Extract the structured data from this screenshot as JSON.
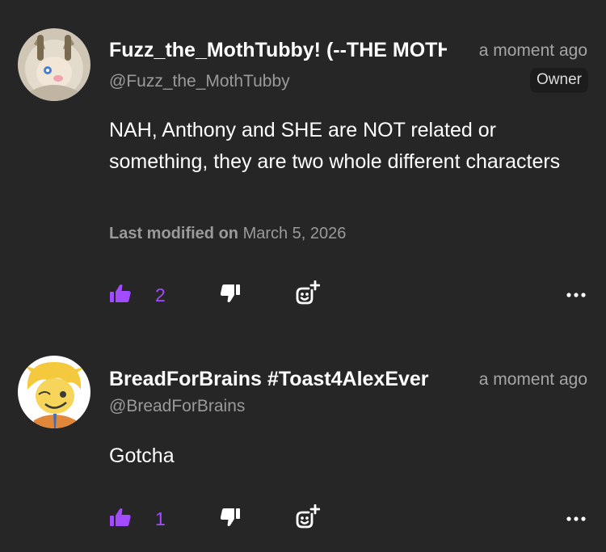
{
  "theme": {
    "background": "#262626",
    "accent": "#a24bff",
    "muted_text": "#9a9a9a"
  },
  "comments": [
    {
      "avatar_icon": "moth-character-avatar",
      "display_name": "Fuzz_the_MothTubby! (--THE MOTH",
      "timestamp": "a moment ago",
      "handle": "@Fuzz_the_MothTubby",
      "badge": "Owner",
      "body": "NAH, Anthony and SHE are NOT related or something, they are two whole different characters",
      "modified_label": "Last modified on",
      "modified_date": "March 5, 2026",
      "likes": "2",
      "icons": {
        "like": "thumbs-up-icon",
        "dislike": "thumbs-down-icon",
        "react": "add-reaction-icon",
        "more": "more-options-icon"
      }
    },
    {
      "avatar_icon": "blonde-character-avatar",
      "display_name": "BreadForBrains #Toast4AlexEver",
      "timestamp": "a moment ago",
      "handle": "@BreadForBrains",
      "body": "Gotcha",
      "likes": "1",
      "icons": {
        "like": "thumbs-up-icon",
        "dislike": "thumbs-down-icon",
        "react": "add-reaction-icon",
        "more": "more-options-icon"
      }
    }
  ]
}
